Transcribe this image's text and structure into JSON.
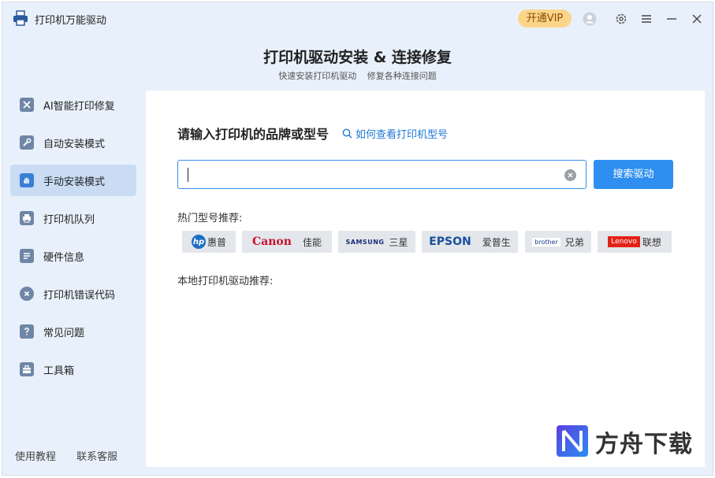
{
  "app": {
    "title": "打印机万能驱动"
  },
  "titlebar": {
    "vip_label": "开通VIP"
  },
  "header": {
    "title": "打印机驱动安装 & 连接修复",
    "subtitle_1": "快速安装打印机驱动",
    "subtitle_2": "修复各种连接问题"
  },
  "sidebar": {
    "items": [
      {
        "label": "AI智能打印修复",
        "icon": "tools-icon"
      },
      {
        "label": "自动安装模式",
        "icon": "wrench-icon"
      },
      {
        "label": "手动安装模式",
        "icon": "hand-icon"
      },
      {
        "label": "打印机队列",
        "icon": "printer-icon"
      },
      {
        "label": "硬件信息",
        "icon": "list-icon"
      },
      {
        "label": "打印机错误代码",
        "icon": "error-icon"
      },
      {
        "label": "常见问题",
        "icon": "question-icon"
      },
      {
        "label": "工具箱",
        "icon": "toolbox-icon"
      }
    ],
    "footer": {
      "tutorial": "使用教程",
      "support": "联系客服"
    }
  },
  "main": {
    "prompt": "请输入打印机的品牌或型号",
    "howto_link": "如何查看打印机型号",
    "search_value": "",
    "search_button": "搜索驱动",
    "hot_label": "热门型号推荐:",
    "brands": [
      {
        "logo": "hp",
        "name": "惠普"
      },
      {
        "logo": "Canon",
        "name": "佳能"
      },
      {
        "logo": "SAMSUNG",
        "name": "三星"
      },
      {
        "logo": "EPSON",
        "name": "爱普生"
      },
      {
        "logo": "brother",
        "name": "兄弟"
      },
      {
        "logo": "Lenovo",
        "name": "联想"
      }
    ],
    "local_label": "本地打印机驱动推荐:"
  },
  "watermark": {
    "text": "方舟下载"
  },
  "colors": {
    "accent": "#2f8ff0",
    "vip": "#fbd68a",
    "active_nav": "#c9dcf4",
    "link": "#1e78d6"
  }
}
